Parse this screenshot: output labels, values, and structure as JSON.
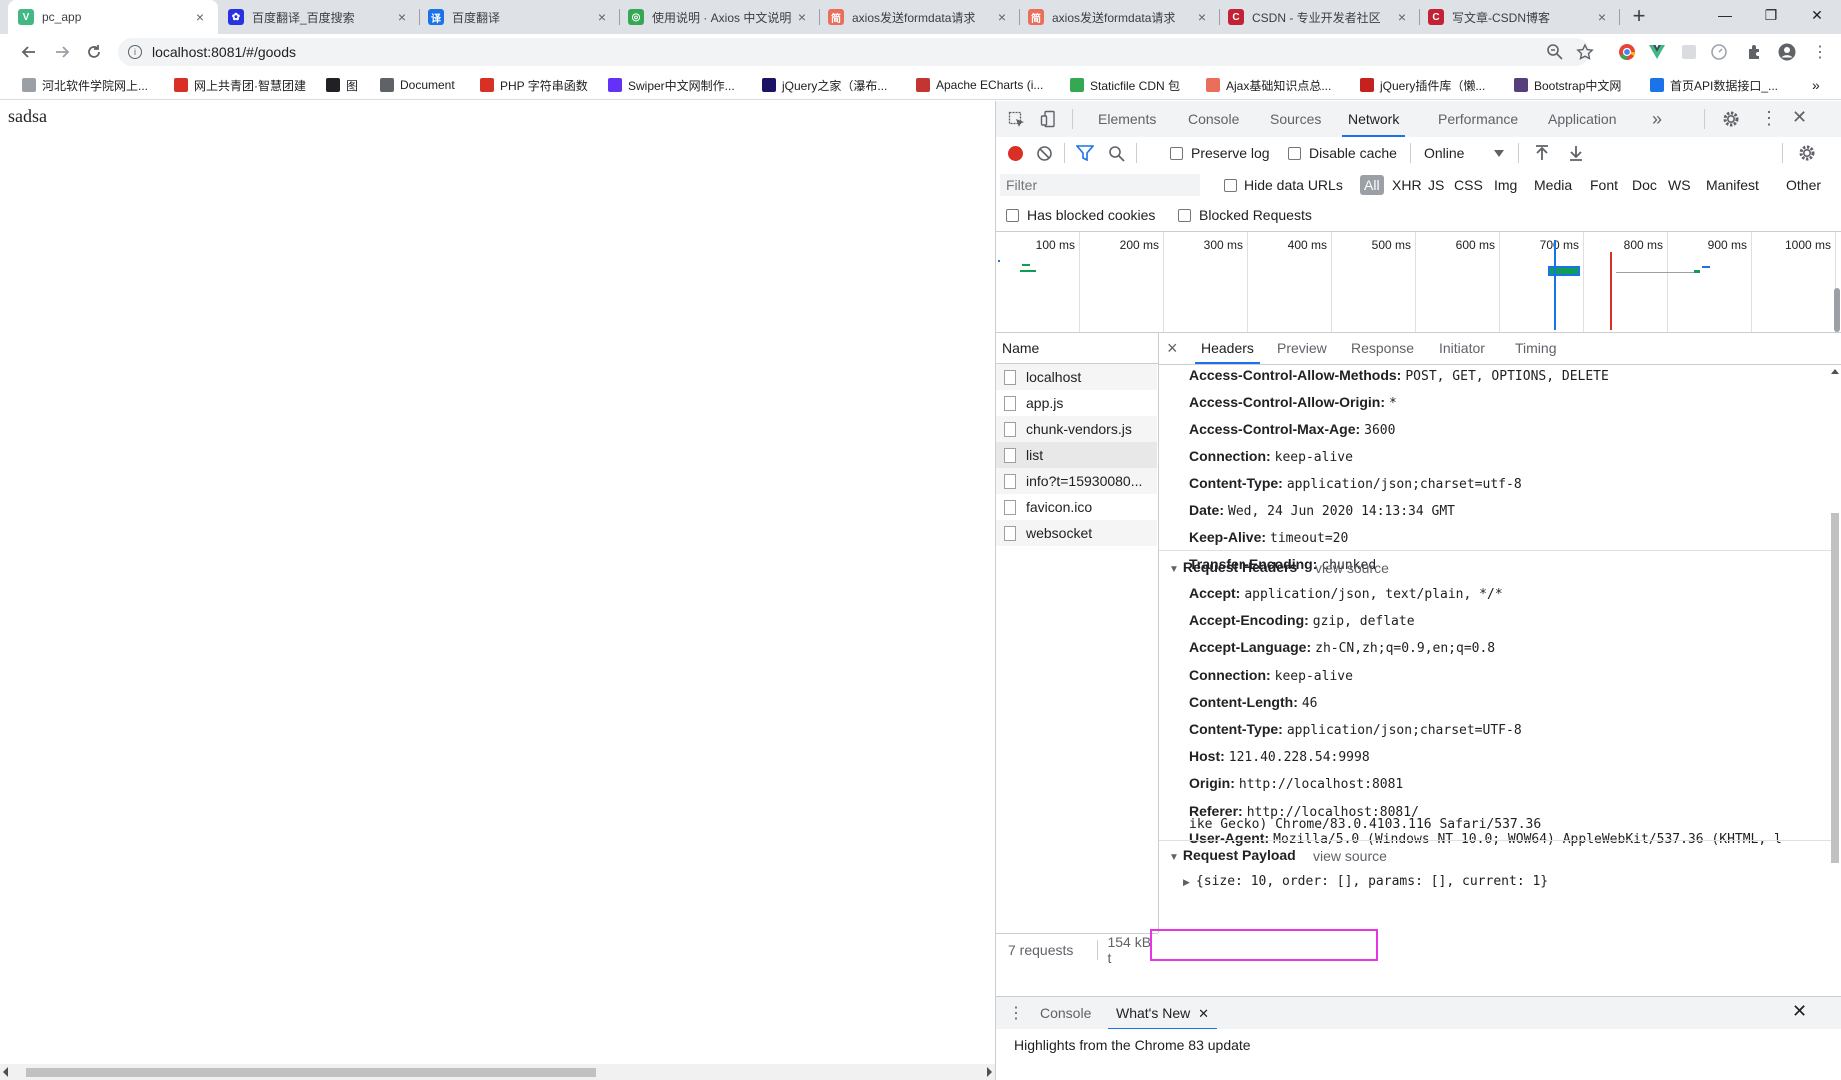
{
  "tabs": [
    {
      "label": "pc_app",
      "color": "#42b883",
      "glyph": "V",
      "active": true
    },
    {
      "label": "百度翻译_百度搜索",
      "color": "#2932e1",
      "glyph": "✿"
    },
    {
      "label": "百度翻译",
      "color": "#1a73e8",
      "glyph": "译"
    },
    {
      "label": "使用说明 · Axios 中文说明",
      "color": "#34a853",
      "glyph": "◎"
    },
    {
      "label": "axios发送formdata请求",
      "color": "#ea6f5a",
      "glyph": "简"
    },
    {
      "label": "axios发送formdata请求",
      "color": "#ea6f5a",
      "glyph": "简"
    },
    {
      "label": "CSDN - 专业开发者社区",
      "color": "#c32136",
      "glyph": "C"
    },
    {
      "label": "写文章-CSDN博客",
      "color": "#c32136",
      "glyph": "C"
    }
  ],
  "new_tab": "+",
  "window": {
    "minimize": "—",
    "maximize": "❐",
    "close": "✕"
  },
  "address": {
    "url": "localhost:8081/#/goods",
    "info": "i"
  },
  "bookmarks": [
    {
      "label": "河北软件学院网上...",
      "color": "#9aa0a6"
    },
    {
      "label": "网上共青团·智慧团建",
      "color": "#d93025"
    },
    {
      "label": "图",
      "color": "#202124"
    },
    {
      "label": "Document",
      "color": "#5f6368"
    },
    {
      "label": "PHP 字符串函数",
      "color": "#d93025"
    },
    {
      "label": "Swiper中文网制作...",
      "color": "#6332f6"
    },
    {
      "label": "jQuery之家（瀑布...",
      "color": "#1b1464"
    },
    {
      "label": "Apache ECharts (i...",
      "color": "#c23531"
    },
    {
      "label": "Staticfile CDN 包",
      "color": "#34a853"
    },
    {
      "label": "Ajax基础知识点总...",
      "color": "#ea6f5a"
    },
    {
      "label": "jQuery插件库（懒...",
      "color": "#c5221f"
    },
    {
      "label": "Bootstrap中文网",
      "color": "#563d7c"
    },
    {
      "label": "首页API数据接口_...",
      "color": "#1a73e8"
    }
  ],
  "bookmarks_more": "»",
  "page": {
    "text": "sadsa"
  },
  "devtools": {
    "tabs": [
      "Elements",
      "Console",
      "Sources",
      "Network",
      "Performance",
      "Application"
    ],
    "active_tab": "Network",
    "more": "»",
    "toolbar": {
      "preserve_log": "Preserve log",
      "disable_cache": "Disable cache",
      "throttle": "Online"
    },
    "filter": {
      "placeholder": "Filter",
      "hide_data_urls": "Hide data URLs",
      "types": [
        "All",
        "XHR",
        "JS",
        "CSS",
        "Img",
        "Media",
        "Font",
        "Doc",
        "WS",
        "Manifest",
        "Other"
      ],
      "active_type": "All",
      "has_blocked_cookies": "Has blocked cookies",
      "blocked_requests": "Blocked Requests"
    },
    "timeline_ticks": [
      "100 ms",
      "200 ms",
      "300 ms",
      "400 ms",
      "500 ms",
      "600 ms",
      "700 ms",
      "800 ms",
      "900 ms",
      "1000 ms"
    ],
    "name_header": "Name",
    "requests": [
      "localhost",
      "app.js",
      "chunk-vendors.js",
      "list",
      "info?t=15930080...",
      "favicon.ico",
      "websocket"
    ],
    "footer": {
      "count": "7 requests",
      "size": "154 kB t"
    },
    "detail_tabs": [
      "Headers",
      "Preview",
      "Response",
      "Initiator",
      "Timing"
    ],
    "active_detail_tab": "Headers",
    "close": "×",
    "response_headers": [
      {
        "name": "Access-Control-Allow-Methods:",
        "value": "POST, GET, OPTIONS, DELETE"
      },
      {
        "name": "Access-Control-Allow-Origin:",
        "value": "*"
      },
      {
        "name": "Access-Control-Max-Age:",
        "value": "3600"
      },
      {
        "name": "Connection:",
        "value": "keep-alive"
      },
      {
        "name": "Content-Type:",
        "value": "application/json;charset=utf-8"
      },
      {
        "name": "Date:",
        "value": "Wed, 24 Jun 2020 14:13:34 GMT"
      },
      {
        "name": "Keep-Alive:",
        "value": "timeout=20"
      },
      {
        "name": "Transfer-Encoding:",
        "value": "chunked"
      }
    ],
    "request_headers_title": "Request Headers",
    "view_source": "view source",
    "request_headers": [
      {
        "name": "Accept:",
        "value": "application/json, text/plain, */*"
      },
      {
        "name": "Accept-Encoding:",
        "value": "gzip, deflate"
      },
      {
        "name": "Accept-Language:",
        "value": "zh-CN,zh;q=0.9,en;q=0.8"
      },
      {
        "name": "Connection:",
        "value": "keep-alive"
      },
      {
        "name": "Content-Length:",
        "value": "46"
      },
      {
        "name": "Content-Type:",
        "value": "application/json;charset=UTF-8"
      },
      {
        "name": "Host:",
        "value": "121.40.228.54:9998"
      },
      {
        "name": "Origin:",
        "value": "http://localhost:8081"
      },
      {
        "name": "Referer:",
        "value": "http://localhost:8081/"
      },
      {
        "name": "User-Agent:",
        "value": "Mozilla/5.0 (Windows NT 10.0; WOW64) AppleWebKit/537.36 (KHTML, l"
      }
    ],
    "user_agent_cont": "ike Gecko) Chrome/83.0.4103.116 Safari/537.36",
    "request_payload_title": "Request Payload",
    "payload": "{size: 10, order: [], params: [], current: 1}",
    "drawer": {
      "tabs": [
        "Console",
        "What's New"
      ],
      "active": "What's New",
      "body": "Highlights from the Chrome 83 update"
    },
    "colors": {
      "accent": "#1a73e8",
      "record": "#d93025",
      "highlight": "#e535e5"
    }
  }
}
